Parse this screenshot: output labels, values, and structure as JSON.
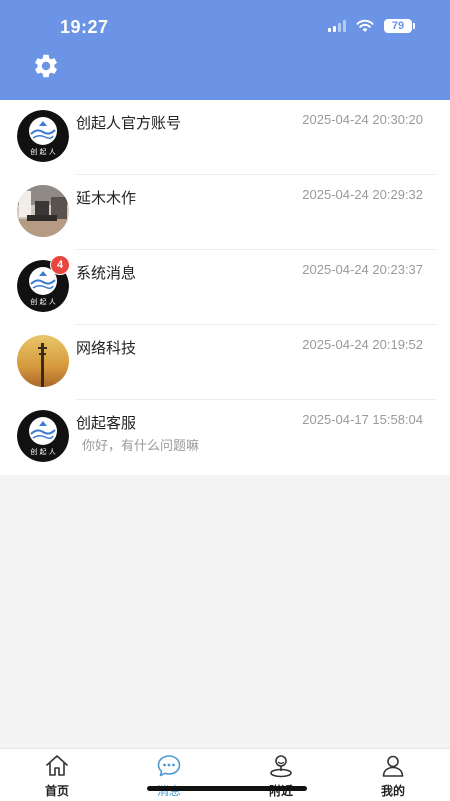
{
  "status_bar": {
    "time": "19:27",
    "battery": "79"
  },
  "header": {
    "settings_icon": "gear-icon"
  },
  "conversations": [
    {
      "name": "创起人官方账号",
      "time": "2025-04-24 20:30:20",
      "preview": "",
      "badge": "",
      "avatar": "brand-logo"
    },
    {
      "name": "延木木作",
      "time": "2025-04-24 20:29:32",
      "preview": "",
      "badge": "",
      "avatar": "room-photo"
    },
    {
      "name": "系统消息",
      "time": "2025-04-24 20:23:37",
      "preview": "",
      "badge": "4",
      "avatar": "brand-logo"
    },
    {
      "name": "网络科技",
      "time": "2025-04-24 20:19:52",
      "preview": "",
      "badge": "",
      "avatar": "tower-sunset-photo"
    },
    {
      "name": "创起客服",
      "time": "2025-04-17 15:58:04",
      "preview": "你好，有什么问题嘛",
      "badge": "",
      "avatar": "brand-logo"
    }
  ],
  "tabbar": {
    "tabs": [
      {
        "label": "首页",
        "icon": "home-icon"
      },
      {
        "label": "消息",
        "icon": "chat-icon"
      },
      {
        "label": "附近",
        "icon": "nearby-icon"
      },
      {
        "label": "我的",
        "icon": "user-icon"
      }
    ],
    "active": "消息"
  },
  "colors": {
    "header": "#6b93e6",
    "accent": "#4a9bd4",
    "badge": "#e8453c"
  }
}
